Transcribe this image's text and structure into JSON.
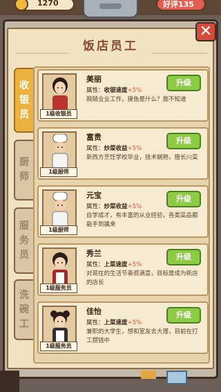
{
  "hud": {
    "coins": "1270",
    "rating": "好评135",
    "colors": {
      "coin": "#f0b73a",
      "rating": "#e55d52"
    }
  },
  "panel": {
    "title": "饭店员工",
    "close_icon": "close-x-icon",
    "colors": {
      "title": "#8a4a31",
      "upgrade": "#8ccb43",
      "bonus": "#e0513c",
      "active_tab": "#ecb13e"
    }
  },
  "tabs": [
    {
      "label": "收银员",
      "chars": [
        "收",
        "银",
        "员"
      ],
      "active": true
    },
    {
      "label": "厨师",
      "chars": [
        "厨",
        "师"
      ],
      "active": false
    },
    {
      "label": "服务员",
      "chars": [
        "服",
        "务",
        "员"
      ],
      "active": false
    },
    {
      "label": "洗碗工",
      "chars": [
        "洗",
        "碗",
        "工"
      ],
      "active": false
    }
  ],
  "staff": [
    {
      "name": "美丽",
      "level": "1级收银员",
      "attr_label": "属性：",
      "attr_name": "收银速度",
      "bonus": "+5%",
      "desc": "兢兢业业工作，摸鱼是什么？我不知道",
      "button": "升级",
      "portrait": "cashier-woman-portrait"
    },
    {
      "name": "富贵",
      "level": "1级厨师",
      "attr_label": "属性：",
      "attr_name": "炒菜收益",
      "bonus": "+5%",
      "desc": "新西方烹饪学校毕业，技术娴熟，擅长川菜",
      "button": "升级",
      "portrait": "chef-man-portrait"
    },
    {
      "name": "元宝",
      "level": "1级厨师",
      "attr_label": "属性：",
      "attr_name": "炒菜收益",
      "bonus": "+5%",
      "desc": "自学成才，有丰富的从业经验，各类菜品都能手到擒来",
      "button": "升级",
      "portrait": "chef-man-portrait"
    },
    {
      "name": "秀兰",
      "level": "1级服务员",
      "attr_label": "属性：",
      "attr_name": "上菜速度",
      "bonus": "+5%",
      "desc": "对现在的生活节奏很满意，目标是成为新店的店长",
      "button": "升级",
      "portrait": "waitress-portrait"
    },
    {
      "name": "佳怡",
      "level": "1级服务员",
      "attr_label": "属性：",
      "attr_name": "上菜速度",
      "bonus": "+5%",
      "desc": "兼职的大学生，想和室友去大理，目前在打工攒钱中",
      "button": "升级",
      "portrait": "waitress-portrait"
    }
  ]
}
